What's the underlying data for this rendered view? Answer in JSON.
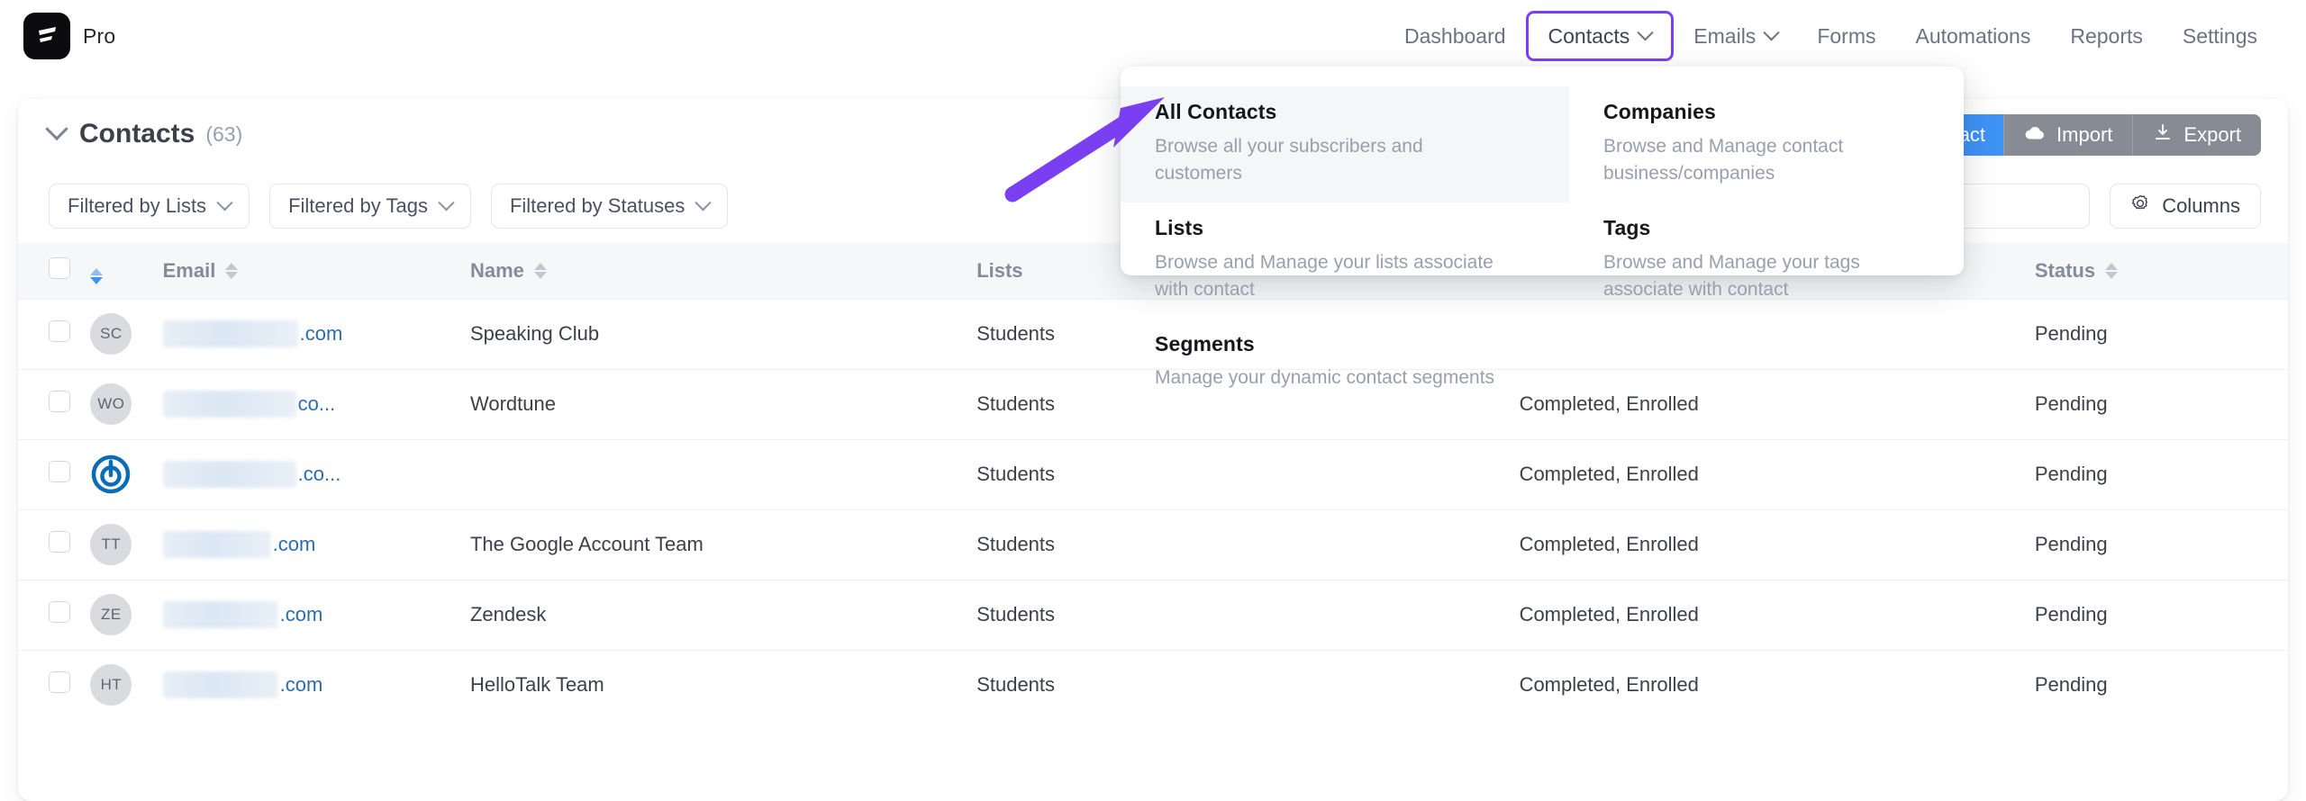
{
  "brand": {
    "plan_label": "Pro",
    "logo_icon": "lightning-slash-logo"
  },
  "nav": {
    "items": [
      {
        "label": "Dashboard",
        "has_caret": false,
        "active": false
      },
      {
        "label": "Contacts",
        "has_caret": true,
        "active": true
      },
      {
        "label": "Emails",
        "has_caret": true,
        "active": false
      },
      {
        "label": "Forms",
        "has_caret": false,
        "active": false
      },
      {
        "label": "Automations",
        "has_caret": false,
        "active": false
      },
      {
        "label": "Reports",
        "has_caret": false,
        "active": false
      },
      {
        "label": "Settings",
        "has_caret": false,
        "active": false
      }
    ],
    "active_outline_color": "#7b3ff2"
  },
  "dropdown": {
    "items": [
      {
        "title": "All Contacts",
        "desc": "Browse all your subscribers and customers",
        "highlight": true
      },
      {
        "title": "Companies",
        "desc": "Browse and Manage contact business/companies",
        "highlight": false
      },
      {
        "title": "Lists",
        "desc": "Browse and Manage your lists associate with contact",
        "highlight": false
      },
      {
        "title": "Tags",
        "desc": "Browse and Manage your tags associate with contact",
        "highlight": false
      },
      {
        "title": "Segments",
        "desc": "Manage your dynamic contact segments",
        "highlight": false
      }
    ]
  },
  "card": {
    "title": "Contacts",
    "count": "(63)",
    "actions": {
      "add_label": "act",
      "add_full_label": "Add Contact",
      "add_color": "#3f93f5",
      "import_label": "Import",
      "export_label": "Export"
    }
  },
  "filters": {
    "pills": [
      {
        "label": "Filtered by Lists"
      },
      {
        "label": "Filtered by Tags"
      },
      {
        "label": "Filtered by Statuses"
      }
    ],
    "search": {
      "value": "",
      "placeholder": "",
      "icon": "search-icon"
    },
    "columns_button": {
      "label": "Columns",
      "icon": "gear-icon"
    }
  },
  "table": {
    "columns": [
      {
        "key": "checkbox",
        "label": "",
        "sortable": false
      },
      {
        "key": "avatar",
        "label": "",
        "sortable": true,
        "sort_active": true
      },
      {
        "key": "email",
        "label": "Email",
        "sortable": true
      },
      {
        "key": "name",
        "label": "Name",
        "sortable": true
      },
      {
        "key": "lists",
        "label": "Lists",
        "sortable": false
      },
      {
        "key": "extra",
        "label": "",
        "sortable": false
      },
      {
        "key": "status",
        "label": "Status",
        "sortable": true
      }
    ],
    "rows": [
      {
        "initials": "SC",
        "avatar_type": "initials",
        "email_redacted": true,
        "email_width": 150,
        "email_tail": ".com",
        "name": "Speaking Club",
        "lists": "Students",
        "extra": "",
        "status": "Pending"
      },
      {
        "initials": "WO",
        "avatar_type": "initials",
        "email_redacted": true,
        "email_width": 148,
        "email_tail": "co...",
        "name": "Wordtune",
        "lists": "Students",
        "extra": "Completed, Enrolled",
        "status": "Pending"
      },
      {
        "initials": "",
        "avatar_type": "logo",
        "email_redacted": true,
        "email_width": 148,
        "email_tail": ".co...",
        "name": "",
        "lists": "Students",
        "extra": "Completed, Enrolled",
        "status": "Pending"
      },
      {
        "initials": "TT",
        "avatar_type": "initials",
        "email_redacted": true,
        "email_width": 120,
        "email_tail": ".com",
        "name": "The Google Account Team",
        "lists": "Students",
        "extra": "Completed, Enrolled",
        "status": "Pending"
      },
      {
        "initials": "ZE",
        "avatar_type": "initials",
        "email_redacted": true,
        "email_width": 128,
        "email_tail": ".com",
        "name": "Zendesk",
        "lists": "Students",
        "extra": "Completed, Enrolled",
        "status": "Pending"
      },
      {
        "initials": "HT",
        "avatar_type": "initials",
        "email_redacted": true,
        "email_width": 128,
        "email_tail": ".com",
        "name": "HelloTalk Team",
        "lists": "Students",
        "extra": "Completed, Enrolled",
        "status": "Pending"
      }
    ]
  },
  "annotation": {
    "arrow_color": "#7b3ff2",
    "points_to": "All Contacts"
  }
}
